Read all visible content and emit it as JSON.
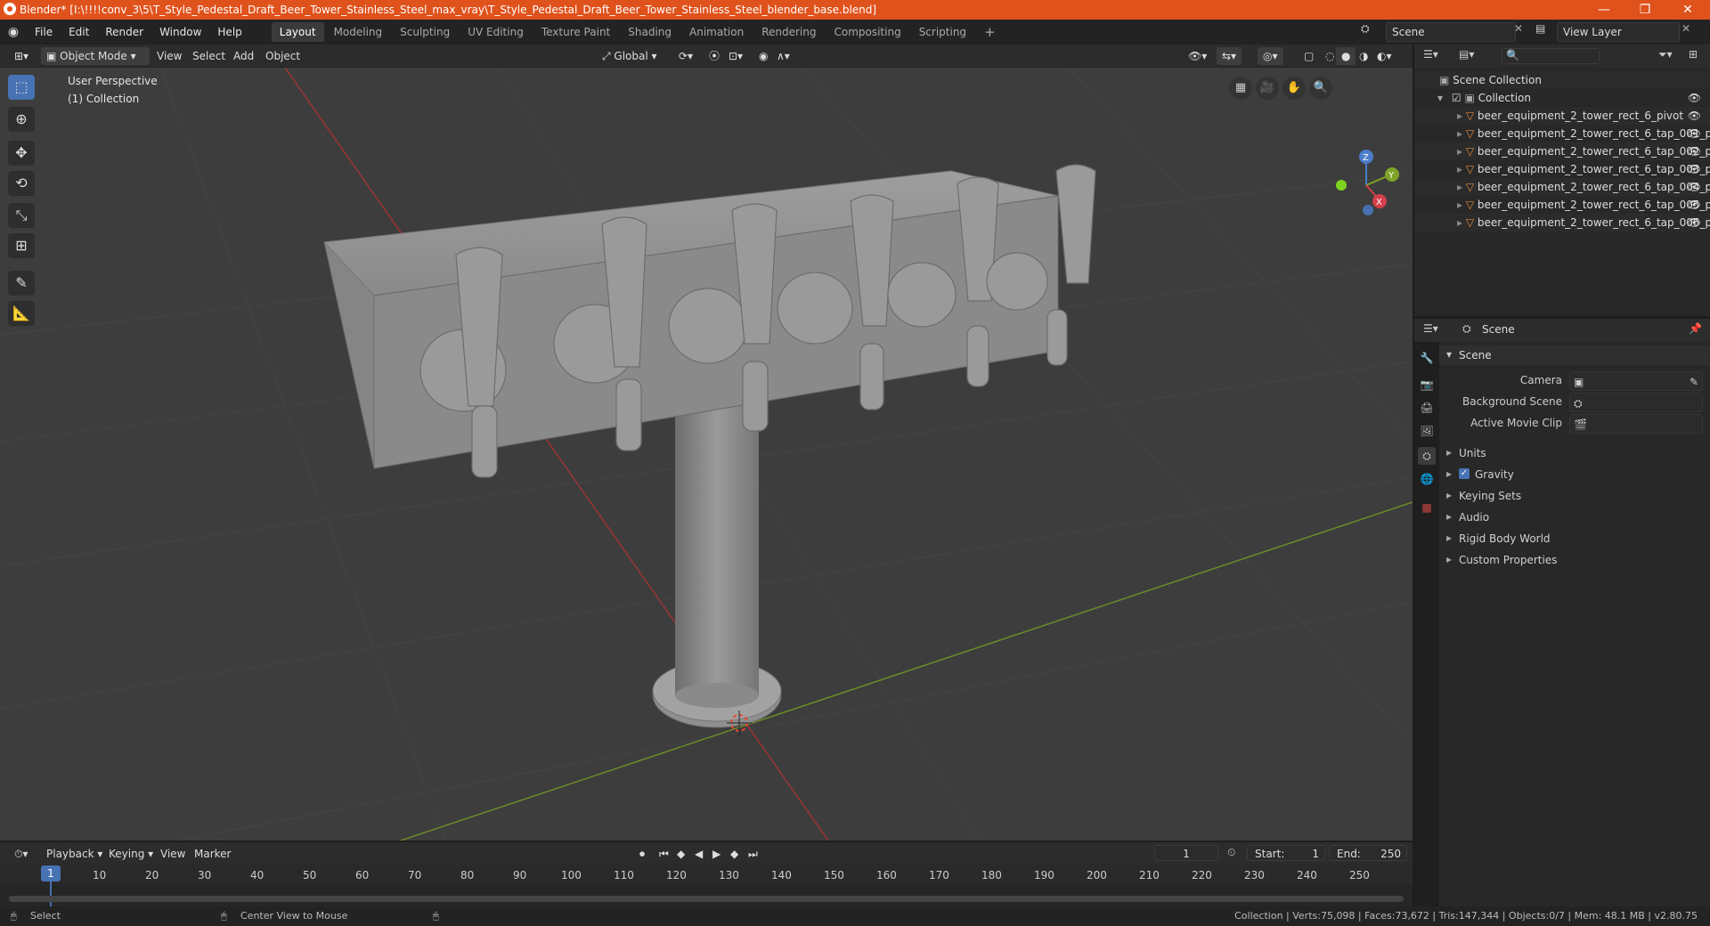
{
  "window": {
    "title": "Blender* [I:\\!!!!conv_3\\5\\T_Style_Pedestal_Draft_Beer_Tower_Stainless_Steel_max_vray\\T_Style_Pedestal_Draft_Beer_Tower_Stainless_Steel_blender_base.blend]",
    "minimize": "—",
    "restore": "❐",
    "close": "✕"
  },
  "menu": {
    "file": "File",
    "edit": "Edit",
    "render": "Render",
    "window": "Window",
    "help": "Help"
  },
  "workspaces": [
    "Layout",
    "Modeling",
    "Sculpting",
    "UV Editing",
    "Texture Paint",
    "Shading",
    "Animation",
    "Rendering",
    "Compositing",
    "Scripting"
  ],
  "workspace_add": "+",
  "scene_field": "Scene",
  "view_layer_field": "View Layer",
  "viewport_header": {
    "mode": "Object Mode",
    "view": "View",
    "select": "Select",
    "add": "Add",
    "object": "Object",
    "transform": "Global"
  },
  "viewport": {
    "perspective": "User Perspective",
    "collection": "(1) Collection",
    "gizmo": {
      "z": "Z",
      "y": "Y",
      "x": "X"
    }
  },
  "outliner": {
    "scene_collection": "Scene Collection",
    "collection": "Collection",
    "items": [
      "beer_equipment_2_tower_rect_6_pivot",
      "beer_equipment_2_tower_rect_6_tap_001_p",
      "beer_equipment_2_tower_rect_6_tap_002_p",
      "beer_equipment_2_tower_rect_6_tap_003_p",
      "beer_equipment_2_tower_rect_6_tap_004_p",
      "beer_equipment_2_tower_rect_6_tap_005_p",
      "beer_equipment_2_tower_rect_6_tap_006_p"
    ]
  },
  "properties": {
    "breadcrumb": "Scene",
    "section": "Scene",
    "camera_label": "Camera",
    "background_label": "Background Scene",
    "clip_label": "Active Movie Clip",
    "panels": [
      "Units",
      "Gravity",
      "Keying Sets",
      "Audio",
      "Rigid Body World",
      "Custom Properties"
    ]
  },
  "timeline": {
    "playback": "Playback",
    "keying": "Keying",
    "view": "View",
    "marker": "Marker",
    "current_frame": "1",
    "start_label": "Start:",
    "start": "1",
    "end_label": "End:",
    "end": "250",
    "ruler": [
      "1",
      "10",
      "20",
      "30",
      "40",
      "50",
      "60",
      "70",
      "80",
      "90",
      "100",
      "110",
      "120",
      "130",
      "140",
      "150",
      "160",
      "170",
      "180",
      "190",
      "200",
      "210",
      "220",
      "230",
      "240",
      "250"
    ]
  },
  "statusbar": {
    "select": "Select",
    "center": "Center View to Mouse",
    "stats": "Collection | Verts:75,098 | Faces:73,672 | Tris:147,344 | Objects:0/7 | Mem: 48.1 MB | v2.80.75"
  },
  "colors": {
    "titlebar": "#e0521c",
    "accent": "#4772b3",
    "x_axis": "#9b3535",
    "y_axis": "#6d8a2a",
    "mesh": "#8c8c8c"
  }
}
